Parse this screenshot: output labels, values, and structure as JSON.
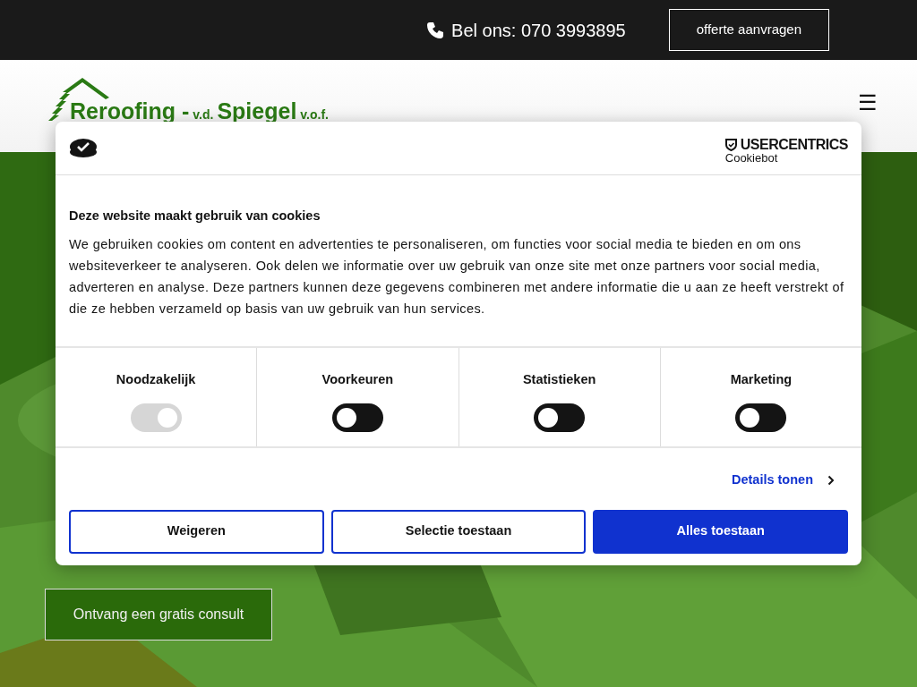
{
  "top_bar": {
    "phone": "Bel ons: 070 3993895",
    "quote_button": "offerte aanvragen"
  },
  "header": {
    "logo": {
      "parts": [
        "Reroofing -",
        "v.d.",
        "Spiegel",
        "v.o.f."
      ]
    },
    "menu_icon": "☰"
  },
  "hero": {
    "cta": "Ontvang een gratis consult"
  },
  "cookie_dialog": {
    "brand": {
      "name": "USERCENTRICS",
      "product": "Cookiebot"
    },
    "title": "Deze website maakt gebruik van cookies",
    "body": "We gebruiken cookies om content en advertenties te personaliseren, om functies voor social media te bieden en om ons websiteverkeer te analyseren. Ook delen we informatie over uw gebruik van onze site met onze partners voor social media, adverteren en analyse. Deze partners kunnen deze gegevens combineren met andere informatie die u aan ze heeft verstrekt of die ze hebben verzameld op basis van uw gebruik van hun services.",
    "categories": [
      {
        "label": "Noodzakelijk",
        "checked": true,
        "disabled": true
      },
      {
        "label": "Voorkeuren",
        "checked": false,
        "disabled": false
      },
      {
        "label": "Statistieken",
        "checked": false,
        "disabled": false
      },
      {
        "label": "Marketing",
        "checked": false,
        "disabled": false
      }
    ],
    "details_link": "Details tonen",
    "buttons": [
      {
        "label": "Weigeren",
        "kind": "outline"
      },
      {
        "label": "Selectie toestaan",
        "kind": "outline"
      },
      {
        "label": "Alles toestaan",
        "kind": "primary"
      }
    ]
  }
}
